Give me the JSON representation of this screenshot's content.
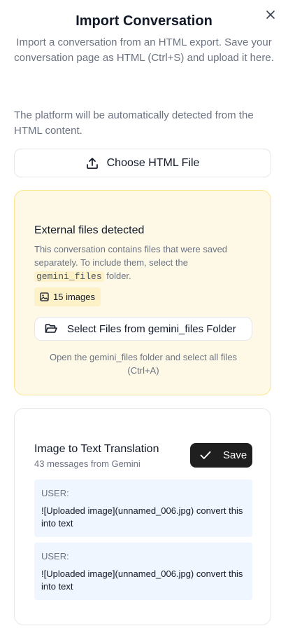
{
  "dialog": {
    "title": "Import Conversation",
    "subtitle": "Import a conversation from an HTML export. Save your conversation page as HTML (Ctrl+S) and upload it here.",
    "detect_note": "The platform will be automatically detected from the HTML content.",
    "choose_label": "Choose HTML File"
  },
  "external": {
    "title": "External files detected",
    "desc_before": "This conversation contains files that were saved separately. To include them, select the ",
    "folder_code": "gemini_files",
    "desc_after": " folder.",
    "image_count": "15 images",
    "select_label": "Select Files from gemini_files Folder",
    "hint": "Open the gemini_files folder and select all files (Ctrl+A)"
  },
  "conversation": {
    "title": "Image to Text Translation",
    "meta": "43 messages from Gemini",
    "save_label": "Save",
    "messages": [
      {
        "role": "USER:",
        "text": "![Uploaded image](unnamed_006.jpg) convert this into text"
      },
      {
        "role": "USER:",
        "text": "![Uploaded image](unnamed_006.jpg) convert this into text"
      }
    ]
  },
  "icons": {
    "close": "close-icon",
    "upload": "upload-icon",
    "image": "image-icon",
    "folder": "folder-open-icon",
    "check": "check-icon"
  },
  "colors": {
    "warning_bg": "#fef9e7",
    "warning_border": "#fde68a",
    "message_bg": "#eff6ff",
    "primary_button": "#1f1f1f"
  }
}
